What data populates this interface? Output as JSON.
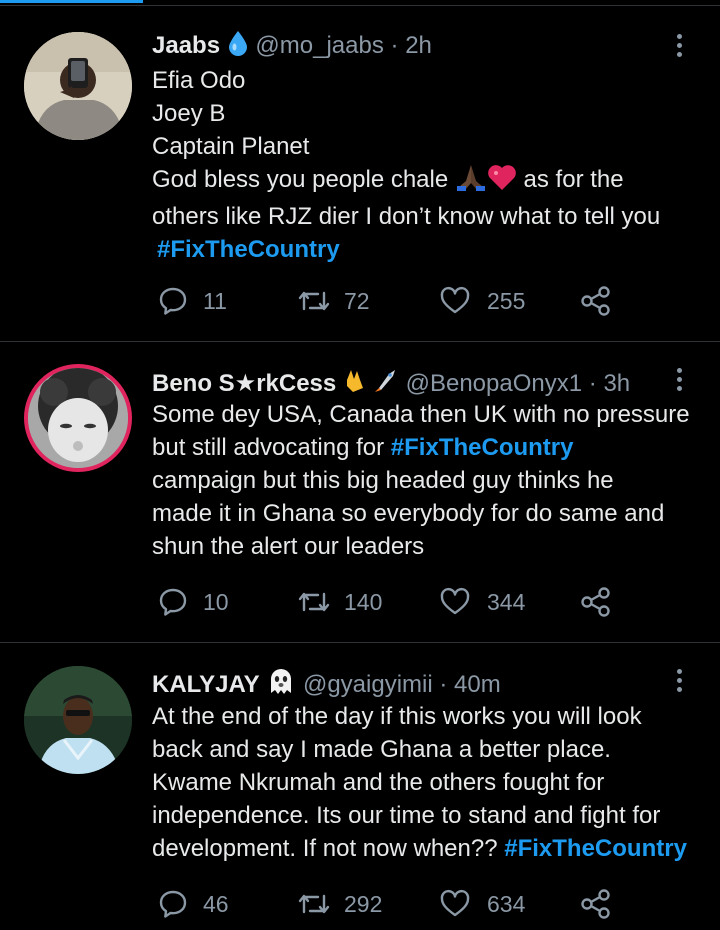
{
  "tweets": [
    {
      "name": "Jaabs",
      "name_emoji": "droplet-icon",
      "handle": "@mo_jaabs",
      "separator": "·",
      "time": "2h",
      "lines": [
        {
          "text": "Efia Odo"
        },
        {
          "text": "Joey B"
        },
        {
          "text": "Captain Planet"
        },
        {
          "pre": "God  bless you people chale ",
          "post": " as for the"
        },
        {
          "text": "others like RJZ dier I don’t know what to tell you"
        },
        {
          "tag": "#FixTheCountry"
        }
      ],
      "reply_count": "11",
      "retweet_count": "72",
      "like_count": "255"
    },
    {
      "name": "Beno S★rkCess",
      "name_emoji": "rock-hand-rocket-icon",
      "handle": "@BenopaOnyx1",
      "separator": "·",
      "time": "3h",
      "lines": [
        {
          "text": "Some dey USA, Canada then UK with no pressure"
        },
        {
          "pre": "but still advocating for ",
          "tag": "#FixTheCountry"
        },
        {
          "text": "campaign but this big headed guy thinks he"
        },
        {
          "text": "made it in Ghana so everybody for do same and"
        },
        {
          "text": "shun the alert our leaders"
        }
      ],
      "reply_count": "10",
      "retweet_count": "140",
      "like_count": "344"
    },
    {
      "name": "KALYJAY",
      "name_emoji": "ghost-icon",
      "handle": "@gyaigyimii",
      "separator": "·",
      "time": "40m",
      "lines": [
        {
          "text": "At the end of the day if this works you will look"
        },
        {
          "text": "back and say I made Ghana a better place."
        },
        {
          "text": "Kwame Nkrumah and the others fought for"
        },
        {
          "text": "independence. Its our time to stand and fight for"
        },
        {
          "pre": "development. If not now when?? ",
          "tag": "#FixTheCountry"
        }
      ],
      "reply_count": "46",
      "retweet_count": "292",
      "like_count": "634"
    }
  ],
  "colors": {
    "background": "#000000",
    "text": "#e7e9ea",
    "muted": "#8b98a5",
    "hashtag": "#1d9bf0",
    "divider": "#2f3336",
    "heart_red": "#e0245e"
  }
}
